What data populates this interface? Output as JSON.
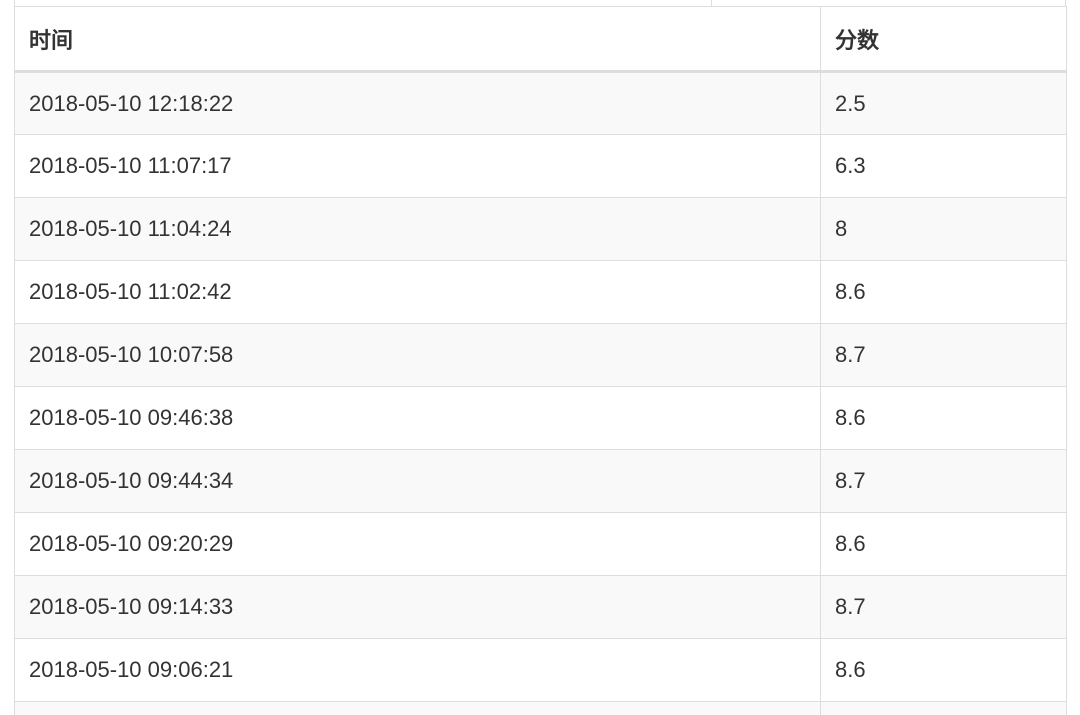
{
  "table": {
    "headers": {
      "time": "时间",
      "score": "分数"
    },
    "rows": [
      {
        "time": "2018-05-10 12:18:22",
        "score": "2.5"
      },
      {
        "time": "2018-05-10 11:07:17",
        "score": "6.3"
      },
      {
        "time": "2018-05-10 11:04:24",
        "score": "8"
      },
      {
        "time": "2018-05-10 11:02:42",
        "score": "8.6"
      },
      {
        "time": "2018-05-10 10:07:58",
        "score": "8.7"
      },
      {
        "time": "2018-05-10 09:46:38",
        "score": "8.6"
      },
      {
        "time": "2018-05-10 09:44:34",
        "score": "8.7"
      },
      {
        "time": "2018-05-10 09:20:29",
        "score": "8.6"
      },
      {
        "time": "2018-05-10 09:14:33",
        "score": "8.7"
      },
      {
        "time": "2018-05-10 09:06:21",
        "score": "8.6"
      }
    ]
  },
  "colors": {
    "border": "#dddddd",
    "stripe": "#f9f9f9",
    "text": "#333333"
  }
}
